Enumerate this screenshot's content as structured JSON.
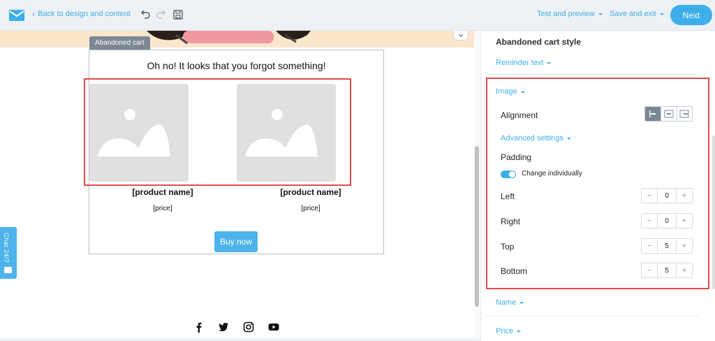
{
  "topbar": {
    "back_label": "Back to design and content",
    "test_preview_label": "Test and preview",
    "save_exit_label": "Save and exit",
    "next_label": "Next"
  },
  "canvas": {
    "block_tag": "Abandoned cart",
    "headline": "Oh no! It looks that you forgot something!",
    "products": [
      {
        "name": "[product name]",
        "price": "[price]"
      },
      {
        "name": "[product name]",
        "price": "[price]"
      }
    ],
    "buy_label": "Buy now",
    "chat_label": "Chat 24/7"
  },
  "panel": {
    "title": "Abandoned cart style",
    "reminder_label": "Reminder text",
    "image_label": "Image",
    "alignment_label": "Alignment",
    "advanced_label": "Advanced settings",
    "padding_label": "Padding",
    "change_individually_label": "Change individually",
    "paddings": [
      {
        "label": "Left",
        "value": "0"
      },
      {
        "label": "Right",
        "value": "0"
      },
      {
        "label": "Top",
        "value": "5"
      },
      {
        "label": "Bottom",
        "value": "5"
      }
    ],
    "name_label": "Name",
    "price_label": "Price"
  },
  "colors": {
    "accent": "#3daee9",
    "highlight": "#e24b4b",
    "topbar_bg": "#edf0f4",
    "placeholder": "#e0e0e0"
  }
}
